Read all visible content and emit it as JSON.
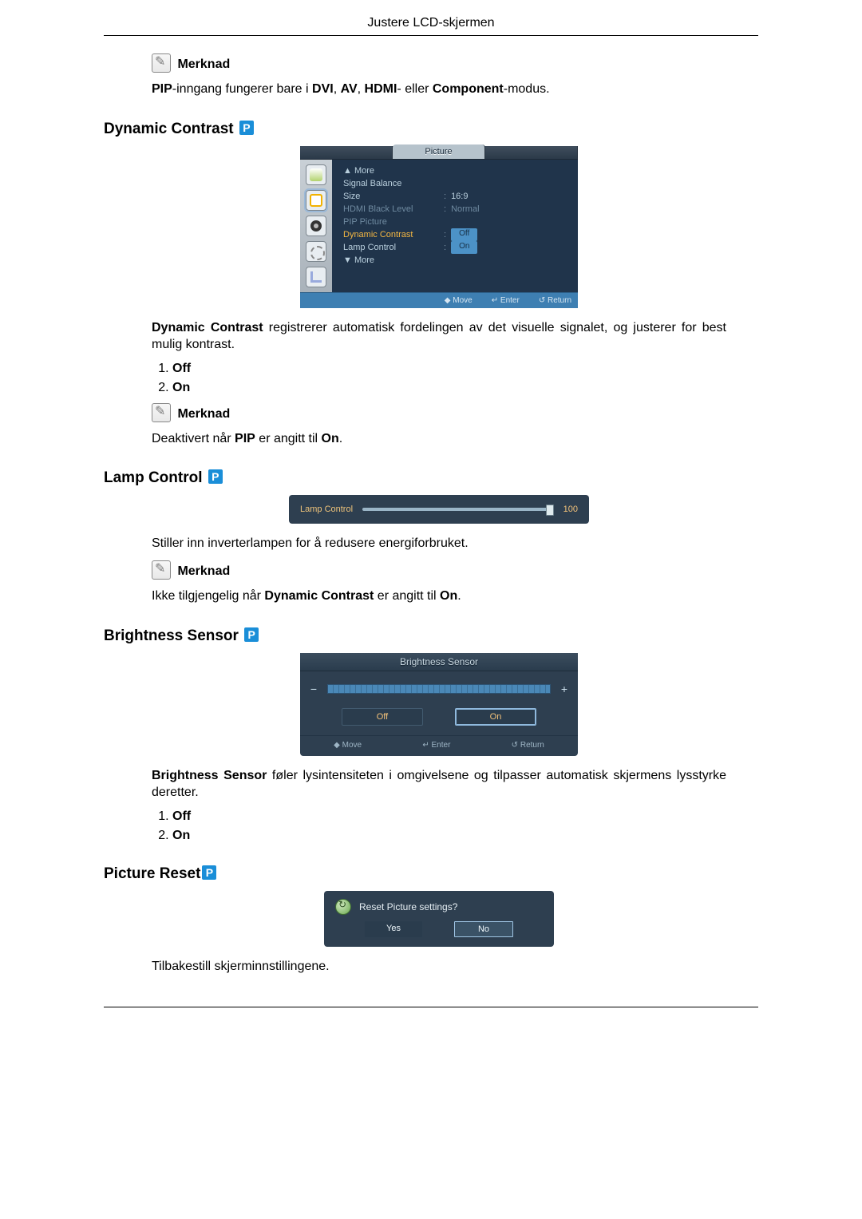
{
  "header": {
    "title": "Justere LCD-skjermen"
  },
  "note_label": "Merknad",
  "p_badge": "P",
  "intro_note": {
    "pre": "PIP",
    "mid": "-inngang fungerer bare i ",
    "b1": "DVI",
    "sep": ", ",
    "b2": "AV",
    "b3": "HDMI",
    "mid2": "- eller ",
    "b4": "Component",
    "end": "-modus."
  },
  "dynamic_contrast": {
    "title": "Dynamic Contrast",
    "osd": {
      "tab_title": "Picture",
      "rows": {
        "more_up": "▲ More",
        "signal_balance": "Signal Balance",
        "size": {
          "label": "Size",
          "value": "16:9"
        },
        "hdmi_black": {
          "label": "HDMI Black Level",
          "value": "Normal"
        },
        "pip_picture": "PIP Picture",
        "dyn_contrast": {
          "label": "Dynamic Contrast",
          "value": "Off"
        },
        "lamp_control": {
          "label": "Lamp Control",
          "value": "On"
        },
        "more_down": "▼ More"
      },
      "footer": {
        "move": "Move",
        "enter": "Enter",
        "return": "Return"
      }
    },
    "desc_b": "Dynamic Contrast",
    "desc": " registrerer automatisk fordelingen av det visuelle signalet, og justerer for best mulig kontrast.",
    "opts": [
      "Off",
      "On"
    ],
    "note_pre": "Deaktivert når ",
    "note_b1": "PIP",
    "note_mid": " er angitt til ",
    "note_b2": "On",
    "note_end": "."
  },
  "lamp_control": {
    "title": "Lamp Control",
    "osd": {
      "label": "Lamp Control",
      "value": "100"
    },
    "desc": "Stiller inn inverterlampen for å redusere energiforbruket.",
    "note_pre": "Ikke tilgjengelig når ",
    "note_b1": "Dynamic Contrast",
    "note_mid": " er angitt til ",
    "note_b2": "On",
    "note_end": "."
  },
  "brightness_sensor": {
    "title": "Brightness Sensor",
    "osd": {
      "head": "Brightness Sensor",
      "minus": "−",
      "plus": "+",
      "off": "Off",
      "on": "On",
      "foot": {
        "move": "Move",
        "enter": "Enter",
        "return": "Return"
      }
    },
    "desc_b": "Brightness Sensor",
    "desc": " føler lysintensiteten i omgivelsene og tilpasser automatisk skjermens lysstyrke deretter.",
    "opts": [
      "Off",
      "On"
    ]
  },
  "picture_reset": {
    "title": "Picture Reset",
    "osd": {
      "q": "Reset Picture settings?",
      "yes": "Yes",
      "no": "No"
    },
    "desc": "Tilbakestill skjerminnstillingene."
  },
  "symbols": {
    "move": "◆",
    "enter": "↵",
    "return": "↺"
  }
}
